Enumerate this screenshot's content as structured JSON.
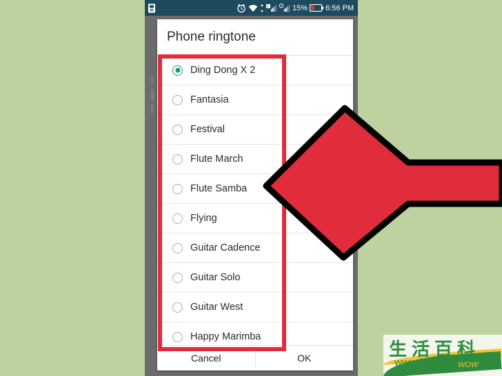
{
  "background": {
    "color": "#bed2a0"
  },
  "phone": {
    "frame_color": "#6c6c6c"
  },
  "status_bar": {
    "background": "#1d4a5e",
    "left_icons": [
      "sim-card-icon"
    ],
    "right_icons": [
      "alarm-clock-icon",
      "wifi-icon",
      "mobile-data-icon",
      "signal-bars-icon"
    ],
    "battery_percent": "15%",
    "battery_icon": "battery-low-icon",
    "time": "6:56 PM"
  },
  "dialog": {
    "title": "Phone ringtone",
    "selected_value": "Ding Dong X 2",
    "accent_color": "#15997c",
    "items": [
      {
        "label": "Ding Dong X 2",
        "selected": true
      },
      {
        "label": "Fantasia",
        "selected": false
      },
      {
        "label": "Festival",
        "selected": false
      },
      {
        "label": "Flute March",
        "selected": false
      },
      {
        "label": "Flute Samba",
        "selected": false
      },
      {
        "label": "Flying",
        "selected": false
      },
      {
        "label": "Guitar Cadence",
        "selected": false
      },
      {
        "label": "Guitar Solo",
        "selected": false
      },
      {
        "label": "Guitar West",
        "selected": false
      },
      {
        "label": "Happy Marimba",
        "selected": false
      }
    ],
    "buttons": {
      "cancel": "Cancel",
      "ok": "OK"
    }
  },
  "annotations": {
    "highlight_box_color": "#e12c3c",
    "arrow_fill": "#e12c3c",
    "arrow_outline": "#000000",
    "arrow_direction": "left"
  },
  "watermark": {
    "chinese_text": "生活百科",
    "url": "www.bimeiz.com",
    "tagline": "WOW",
    "color": "#2f8c3e",
    "accent": "#f4c430"
  }
}
